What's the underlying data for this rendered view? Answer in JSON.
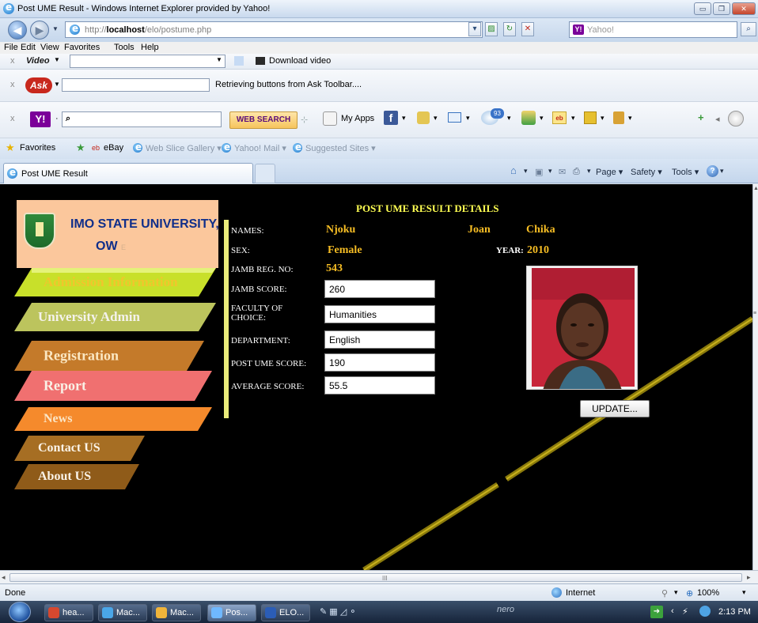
{
  "window": {
    "title": "Post UME Result - Windows Internet Explorer provided by Yahoo!",
    "minimize": "▭",
    "restore": "❐",
    "close": "✕"
  },
  "address": {
    "url_prefix": "http://",
    "url_host": "localhost",
    "url_path": "/elo/postume.php",
    "search_placeholder": "Yahoo!",
    "search_brand": "Y!"
  },
  "menu": [
    "File",
    "Edit",
    "View",
    "Favorites",
    "Tools",
    "Help"
  ],
  "toolbars": {
    "video_label": "Video",
    "download_video": "Download video",
    "ask_brand": "Ask",
    "ask_status": "Retrieving buttons from Ask Toolbar....",
    "yahoo_brand": "Y!",
    "web_search": "WEB SEARCH",
    "my_apps": "My Apps",
    "mail_badge": "93"
  },
  "favorites": {
    "label": "Favorites",
    "items": [
      "eBay",
      "Web Slice Gallery ▾",
      "Yahoo! Mail ▾",
      "Suggested Sites ▾"
    ]
  },
  "tab": {
    "title": "Post UME Result"
  },
  "commandbar": {
    "page": "Page ▾",
    "safety": "Safety ▾",
    "tools": "Tools ▾"
  },
  "site": {
    "univ_name": "IMO STATE UNIVERSITY,",
    "univ_sub": "OW",
    "univ_sub_trail": "E",
    "nav": [
      {
        "label": "Admission Information"
      },
      {
        "label": "University Admin"
      },
      {
        "label": "Registration"
      },
      {
        "label": "Report"
      },
      {
        "label": "News"
      },
      {
        "label": "Contact US"
      },
      {
        "label": "About US"
      }
    ]
  },
  "result": {
    "title": "POST UME RESULT DETAILS",
    "names_label": "NAMES:",
    "surname": "Njoku",
    "first_name": "Joan",
    "middle_name": "Chika",
    "sex_label": "SEX:",
    "sex": "Female",
    "year_label": "YEAR:",
    "year": "2010",
    "jamb_reg_label": "JAMB REG. NO:",
    "jamb_reg": "543",
    "jamb_score_label": "JAMB SCORE:",
    "jamb_score": "260",
    "faculty_label_1": "FACULTY OF",
    "faculty_label_2": "CHOICE:",
    "faculty": "Humanities",
    "department_label": "DEPARTMENT:",
    "department": "English",
    "post_ume_label": "POST UME SCORE:",
    "post_ume": "190",
    "average_label": "AVERAGE SCORE:",
    "average": "55.5",
    "update_button": "UPDATE..."
  },
  "status": {
    "text": "Done",
    "zone": "Internet",
    "zoom": "100%"
  },
  "taskbar": {
    "items": [
      "hea...",
      "Mac...",
      "Mac...",
      "Pos...",
      "ELO..."
    ],
    "nero": "nero",
    "clock": "2:13 PM"
  }
}
